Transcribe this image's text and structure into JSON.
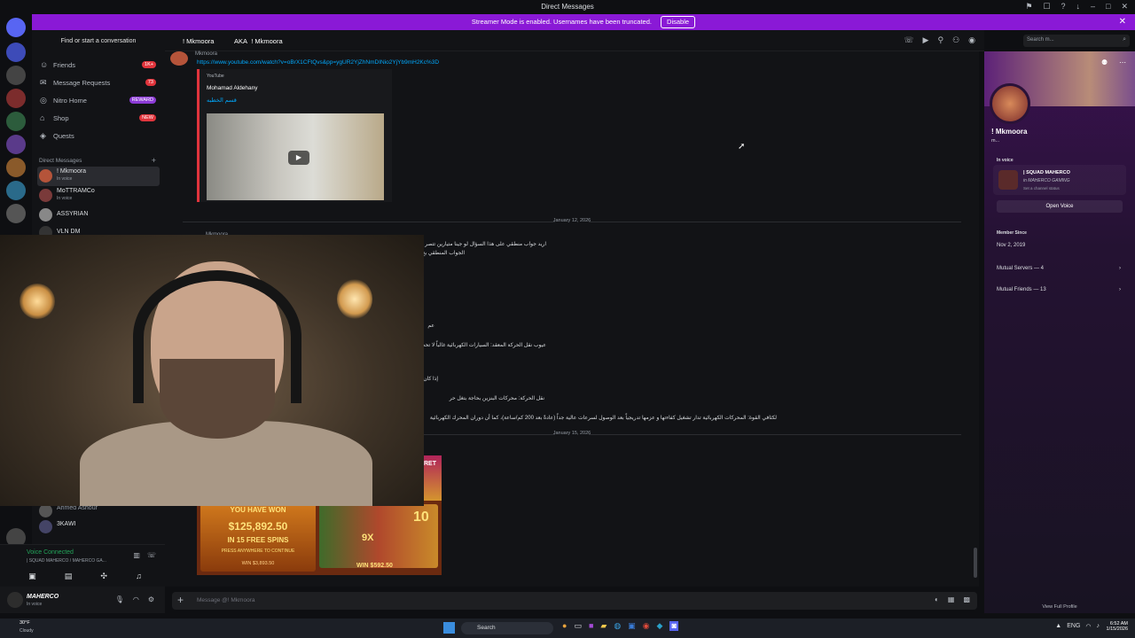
{
  "window": {
    "title": "Direct Messages"
  },
  "banner": {
    "text": "Streamer Mode is enabled. Usernames have been truncated.",
    "disable_label": "Disable"
  },
  "sidebar": {
    "find_label": "Find or start a conversation",
    "nav": [
      {
        "label": "Friends",
        "badge": "1K+",
        "icon": "friends-icon"
      },
      {
        "label": "Message Requests",
        "badge": "73",
        "icon": "envelope-icon"
      },
      {
        "label": "Nitro Home",
        "badge": "REWARD",
        "icon": "nitro-icon"
      },
      {
        "label": "Shop",
        "badge": "NEW",
        "icon": "shop-icon"
      },
      {
        "label": "Quests",
        "badge": "",
        "icon": "quests-icon"
      }
    ],
    "dm_header": "Direct Messages",
    "dms": [
      {
        "name": "! Mkmoora",
        "status": "In voice"
      },
      {
        "name": "MoTTRAMCo",
        "status": "In voice"
      },
      {
        "name": "ASSYRIAN",
        "status": ""
      },
      {
        "name": "VLN DM",
        "status": ""
      },
      {
        "name": "Ahmed Ashour",
        "status": ""
      },
      {
        "name": "3KAWI",
        "status": ""
      }
    ]
  },
  "voice": {
    "status": "Voice Connected",
    "server": "| SQUAD MAHERCO / MAHERCO GA..."
  },
  "user": {
    "name": "MAHERCO",
    "status": "In voice"
  },
  "chat_header": {
    "name": "! Mkmoora",
    "aka_label": "AKA",
    "aka_name": "! Mkmoora",
    "search_placeholder": "Search m..."
  },
  "messages": {
    "top_author": "Mkmoora",
    "link": "https://www.youtube.com/watch?v=oBrX1CFtQvs&pp=ygUR2YjZhNmDINio2YjYb9mH2Kc%3D",
    "embed": {
      "provider": "YouTube",
      "author": "Mohamad Aldehany",
      "title": "قسم الخطبه"
    },
    "date1": "January 12, 2026",
    "second_author": "Mkmoora",
    "lines": [
      "اريد جواب منطقي على هذا السؤال لو جينا متيارين تتصر",
      "الجواب المنطقي بخ",
      "عم",
      "عيوب نقل الحركة المعقد: السيارات الكهربائية غالباً لا تحت",
      "إذا كان",
      "نقل الحركة: محركات البنزين بحاجة بتغل حر",
      "لكثافي القوة: المحركات الكهربائية تدار تشغيل كفاءتها و عزمها تدريجياً بعد الوصول لسرعات عالية جداً (عادةً بعد 200 كم/ساعة)، كما أن دوران المحرك الكهربائية"
    ],
    "date2": "January 15, 2026"
  },
  "slot": {
    "won_title": "YOU HAVE WON",
    "amount": "$125,892.50",
    "free_spins": "IN 15 FREE SPINS",
    "press": "PRESS ANYWHERE TO CONTINUE",
    "win_small": "WIN $3,893.50",
    "win2": "WIN $592.50",
    "x10": "10",
    "mult": "9X"
  },
  "composer": {
    "placeholder": "Message @! Mkmoora"
  },
  "profile": {
    "name": "! Mkmoora",
    "subtitle": "m...",
    "in_voice_label": "In voice",
    "voice_server": "| SQUAD MAHERCO",
    "voice_channel": "in MAHERCO GAMING",
    "channel_status": "Set a channel status",
    "open_voice": "Open Voice",
    "member_since_label": "Member Since",
    "member_since": "Nov 2, 2019",
    "mutual_servers": "Mutual Servers — 4",
    "mutual_friends": "Mutual Friends — 13",
    "view_full": "View Full Profile"
  },
  "taskbar": {
    "weather_temp": "30°F",
    "weather_desc": "Cloudy",
    "search": "Search",
    "lang": "ENG",
    "time": "6:52 AM",
    "date": "1/15/2026"
  },
  "colors": {
    "accent": "#8a19d6",
    "link": "#00a8fc",
    "danger": "#e0343c",
    "online": "#23a55a"
  }
}
